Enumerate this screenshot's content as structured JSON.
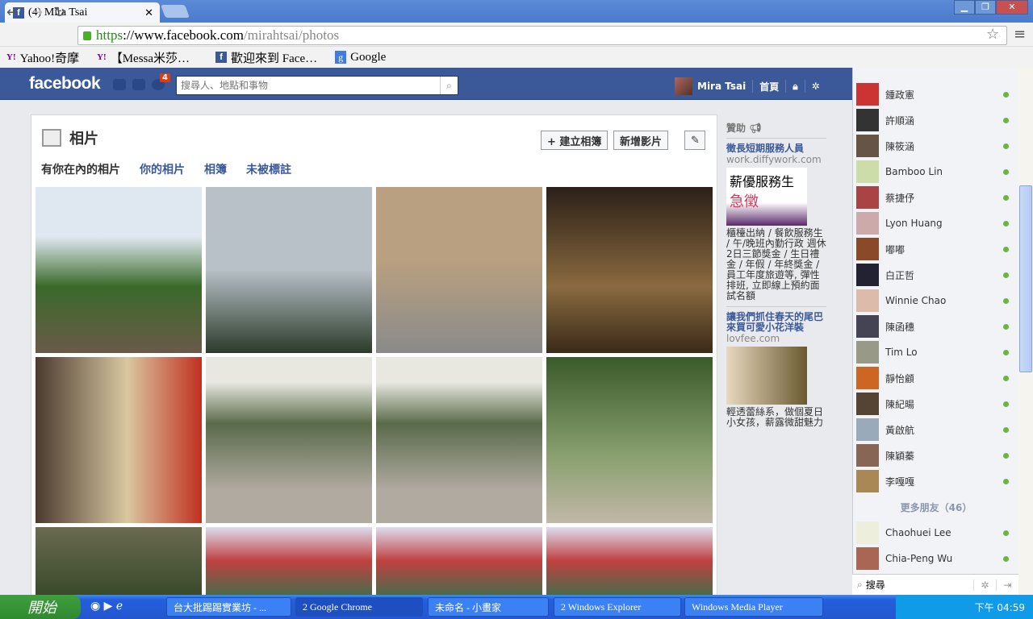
{
  "browser": {
    "tab_title": "(4) Mira Tsai",
    "url_scheme": "https",
    "url_host": "://www.facebook.com",
    "url_path": "/mirahtsai/photos",
    "bookmarks": [
      "Yahoo!奇摩",
      "【Messa米莎…",
      "歡迎來到 Face…",
      "Google"
    ]
  },
  "fb": {
    "logo": "facebook",
    "notification_count": "4",
    "search_placeholder": "搜尋人、地點和事物",
    "user_name": "Mira Tsai",
    "home": "首頁"
  },
  "photos": {
    "title": "相片",
    "create_album": "+ 建立相簿",
    "add_video": "新增影片",
    "tabs": [
      "有你在內的相片",
      "你的相片",
      "相簿",
      "未被標註"
    ]
  },
  "ads": {
    "header": "贊助",
    "items": [
      {
        "title": "徵長短期服務人員",
        "domain": "work.diffywork.com",
        "image_text1": "薪優服務生",
        "image_text2": "急徵",
        "body": "櫃檯出納 / 餐飲服務生 / 午/晚班內勤行政 週休2日三節獎金 / 生日禮金 / 年假 / 年終獎金 / 員工年度旅遊等, 彈性排班, 立即線上預約面試名額"
      },
      {
        "title": "讓我們抓住春天的尾巴來買可愛小花洋裝",
        "domain": "lovfee.com",
        "body": "輕透蕾絲系，做個夏日小女孩，薪露微甜魅力"
      }
    ]
  },
  "chat": {
    "online": [
      "鍾政憲",
      "許順涵",
      "陳筱涵",
      "Bamboo Lin",
      "蔡捷伃",
      "Lyon Huang",
      "嘟嘟",
      "白正哲",
      "Winnie Chao",
      "陳函穗",
      "Tim Lo",
      "靜怡顧",
      "陳紀暘",
      "黃啟航",
      "陳穎蓁",
      "李嘎嘎"
    ],
    "more_label": "更多朋友（46）",
    "more": [
      "Chaohuei Lee",
      "Chia-Peng Wu"
    ],
    "search_placeholder": "搜尋"
  },
  "taskbar": {
    "start": "開始",
    "tasks": [
      "台大批踢踢實業坊 - ...",
      "2 Google Chrome",
      "未命名 - 小畫家",
      "2 Windows Explorer",
      "Windows Media Player"
    ],
    "clock": "下午 04:59"
  }
}
